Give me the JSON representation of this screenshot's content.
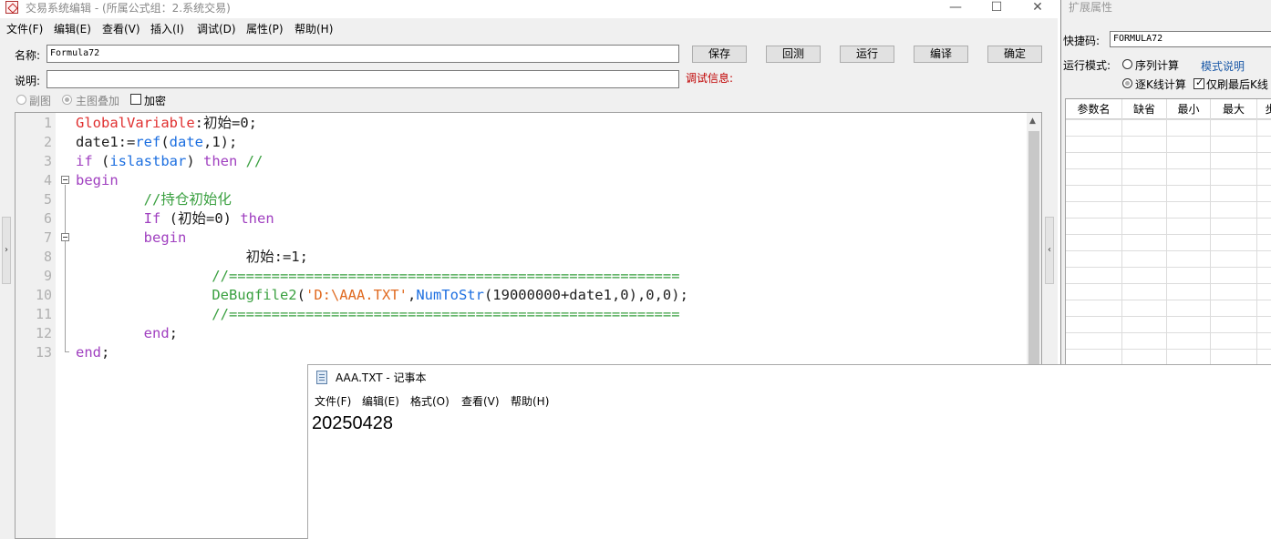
{
  "editor": {
    "title": "交易系统编辑 - (所属公式组：2.系统交易)",
    "window_buttons": {
      "minimize": "—",
      "maximize": "☐",
      "close": "✕"
    },
    "menu": [
      "文件(F)",
      "编辑(E)",
      "查看(V)",
      "插入(I)",
      "调试(D)",
      "属性(P)",
      "帮助(H)"
    ],
    "name_label": "名称:",
    "name_value": "Formula72",
    "desc_label": "说明:",
    "desc_value": "",
    "buttons": {
      "save": "保存",
      "back": "回测",
      "run": "运行",
      "compile": "编译",
      "ok": "确定"
    },
    "debug_label": "调试信息:",
    "options": {
      "sub_chart": "副图",
      "main_overlay": "主图叠加",
      "encrypt": "加密"
    },
    "code": {
      "line_numbers": [
        "1",
        "2",
        "3",
        "4",
        "5",
        "6",
        "7",
        "8",
        "9",
        "10",
        "11",
        "12",
        "13"
      ],
      "lines": [
        [
          {
            "t": "GlobalVariable",
            "c": "red"
          },
          {
            "t": ":初始=0;",
            "c": "plain"
          }
        ],
        [
          {
            "t": "date1:=",
            "c": "plain"
          },
          {
            "t": "ref",
            "c": "blue"
          },
          {
            "t": "(",
            "c": "plain"
          },
          {
            "t": "date",
            "c": "blue"
          },
          {
            "t": ",1);",
            "c": "plain"
          }
        ],
        [
          {
            "t": "if",
            "c": "purple"
          },
          {
            "t": " (",
            "c": "plain"
          },
          {
            "t": "islastbar",
            "c": "blue"
          },
          {
            "t": ") ",
            "c": "plain"
          },
          {
            "t": "then",
            "c": "purple"
          },
          {
            "t": " //",
            "c": "green"
          }
        ],
        [
          {
            "t": "begin",
            "c": "purple"
          }
        ],
        [
          {
            "t": "        //持仓初始化",
            "c": "green"
          }
        ],
        [
          {
            "t": "        ",
            "c": "plain"
          },
          {
            "t": "If",
            "c": "purple"
          },
          {
            "t": " (初始=0) ",
            "c": "plain"
          },
          {
            "t": "then",
            "c": "purple"
          }
        ],
        [
          {
            "t": "        ",
            "c": "plain"
          },
          {
            "t": "begin",
            "c": "purple"
          }
        ],
        [
          {
            "t": "                    初始:=1;",
            "c": "plain"
          }
        ],
        [
          {
            "t": "                //=====================================================",
            "c": "green"
          }
        ],
        [
          {
            "t": "                ",
            "c": "plain"
          },
          {
            "t": "DeBugfile2",
            "c": "green"
          },
          {
            "t": "(",
            "c": "plain"
          },
          {
            "t": "'D:\\AAA.TXT'",
            "c": "orange"
          },
          {
            "t": ",",
            "c": "plain"
          },
          {
            "t": "NumToStr",
            "c": "blue"
          },
          {
            "t": "(19000000+date1,0),0,0);",
            "c": "plain"
          }
        ],
        [
          {
            "t": "                //=====================================================",
            "c": "green"
          }
        ],
        [
          {
            "t": "        ",
            "c": "plain"
          },
          {
            "t": "end",
            "c": "purple"
          },
          {
            "t": ";",
            "c": "plain"
          }
        ],
        [
          {
            "t": "end",
            "c": "purple"
          },
          {
            "t": ";",
            "c": "plain"
          }
        ]
      ]
    }
  },
  "props": {
    "title": "扩展属性",
    "hotkey_label": "快捷码:",
    "hotkey_value": "FORMULA72",
    "run_mode_label": "运行模式:",
    "seq_calc": "序列计算",
    "template_link": "模式说明",
    "per_bar_calc": "逐K线计算",
    "refresh_last": "仅刷最后K线",
    "grid_headers": [
      "参数名",
      "缺省",
      "最小",
      "最大",
      "步"
    ]
  },
  "notepad": {
    "title": "AAA.TXT - 记事本",
    "menu": [
      "文件(F)",
      "编辑(E)",
      "格式(O)",
      "查看(V)",
      "帮助(H)"
    ],
    "content": "20250428"
  },
  "colors": {
    "keyword_red": "#e03030",
    "keyword_purple": "#a040c0",
    "keyword_blue": "#1d6fe0",
    "comment_green": "#3aa040",
    "string_orange": "#e06a20",
    "debug_red": "#c00000",
    "link_blue": "#1c5aa8"
  }
}
